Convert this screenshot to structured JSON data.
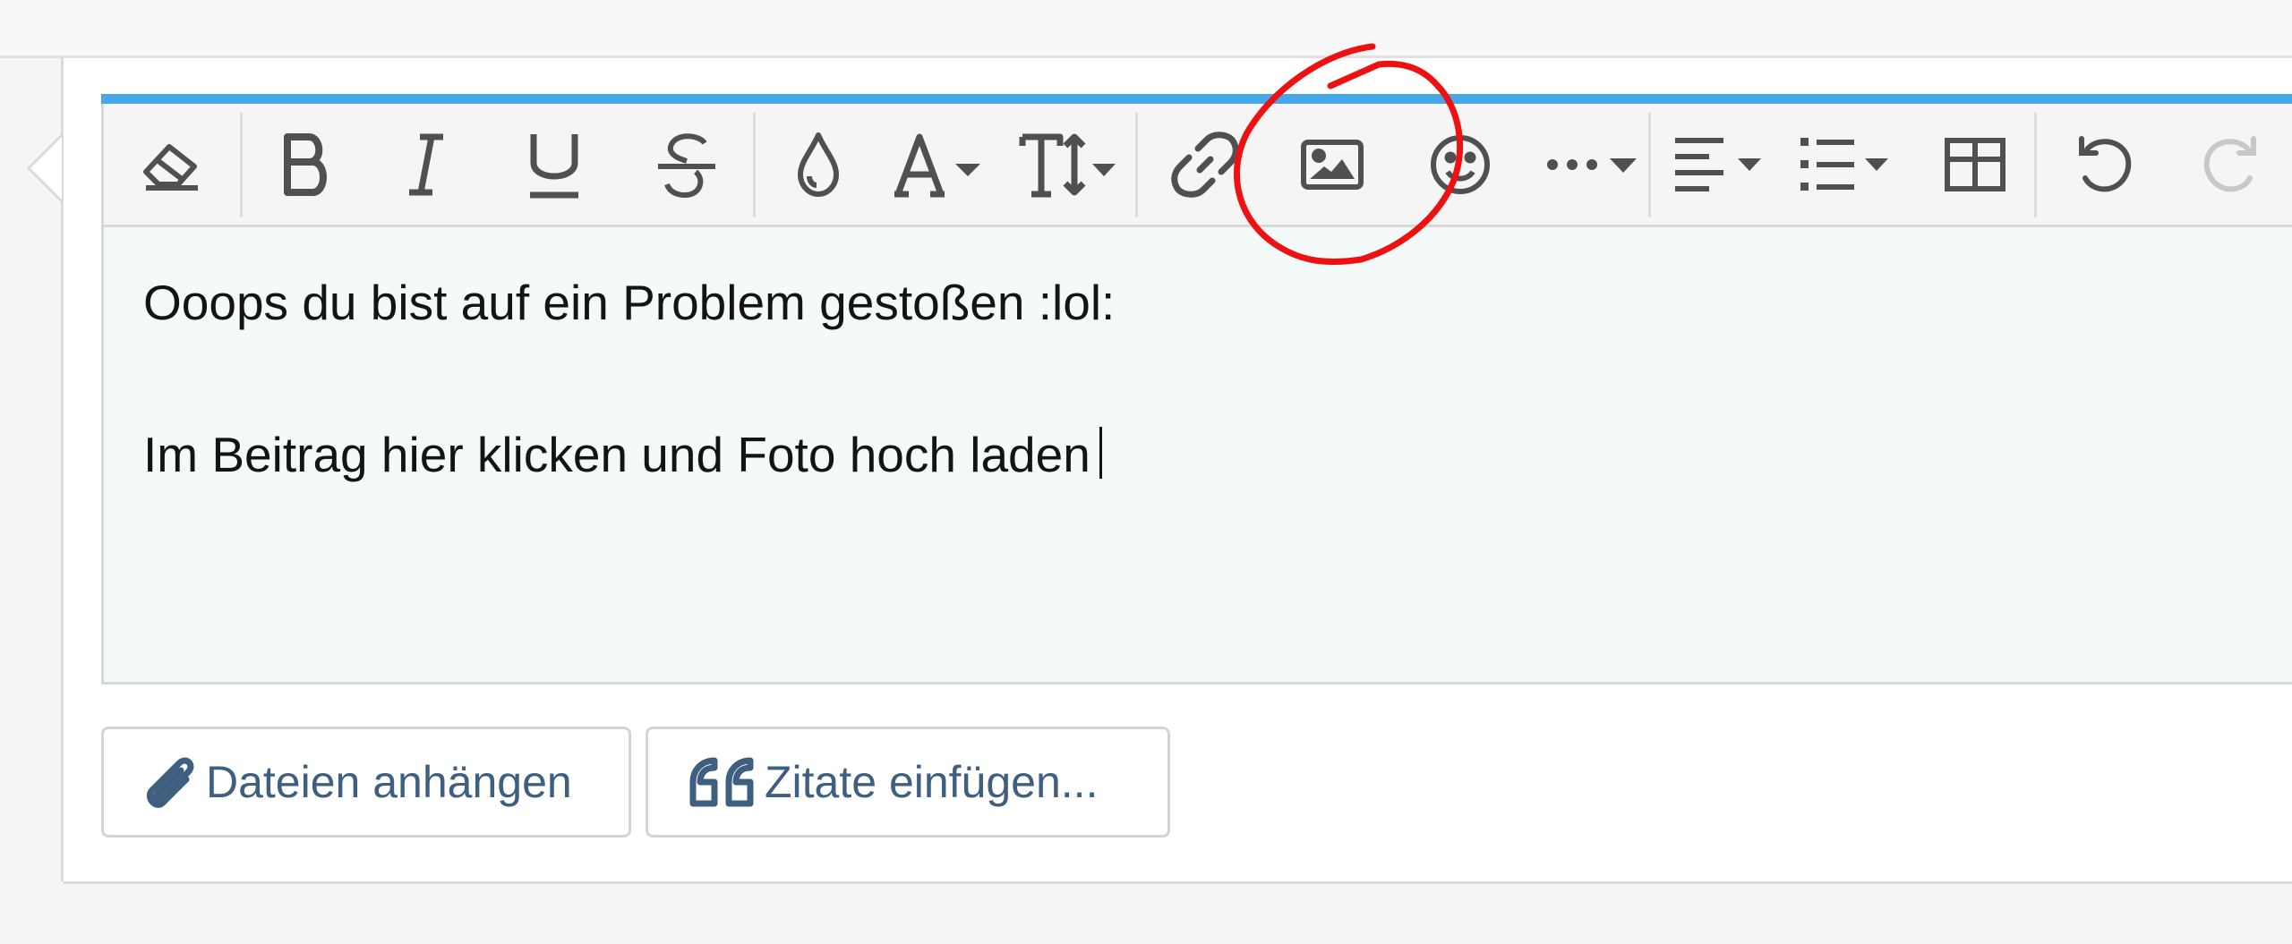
{
  "toolbar": {
    "items": [
      {
        "name": "clear-formatting",
        "icon": "eraser-icon"
      },
      {
        "name": "bold",
        "icon": "bold-icon",
        "glyph": "B"
      },
      {
        "name": "italic",
        "icon": "italic-icon",
        "glyph": "I"
      },
      {
        "name": "underline",
        "icon": "underline-icon",
        "glyph": "U"
      },
      {
        "name": "strikethrough",
        "icon": "strikethrough-icon",
        "glyph": "S"
      },
      {
        "name": "text-color",
        "icon": "droplet-icon"
      },
      {
        "name": "font-family",
        "icon": "font-icon",
        "glyph": "A"
      },
      {
        "name": "font-size",
        "icon": "text-height-icon",
        "glyph": "T"
      },
      {
        "name": "insert-link",
        "icon": "link-icon"
      },
      {
        "name": "insert-image",
        "icon": "image-icon"
      },
      {
        "name": "insert-smilie",
        "icon": "smile-icon"
      },
      {
        "name": "more-options",
        "icon": "ellipsis-icon"
      },
      {
        "name": "align",
        "icon": "align-left-icon"
      },
      {
        "name": "list",
        "icon": "list-icon"
      },
      {
        "name": "insert-table",
        "icon": "table-icon"
      },
      {
        "name": "undo",
        "icon": "undo-icon"
      },
      {
        "name": "redo",
        "icon": "redo-icon"
      }
    ]
  },
  "editor": {
    "line1": "Ooops du bist auf ein Problem gestoßen :lol:",
    "line2": "Im Beitrag hier klicken und Foto hoch laden"
  },
  "actions": {
    "attach_label": "Dateien anhängen",
    "quote_label": "Zitate einfügen..."
  },
  "colors": {
    "accent": "#47a7eb",
    "toolbar_icon": "#505050",
    "button_text": "#3f5f80",
    "annotation": "#ee1111"
  }
}
